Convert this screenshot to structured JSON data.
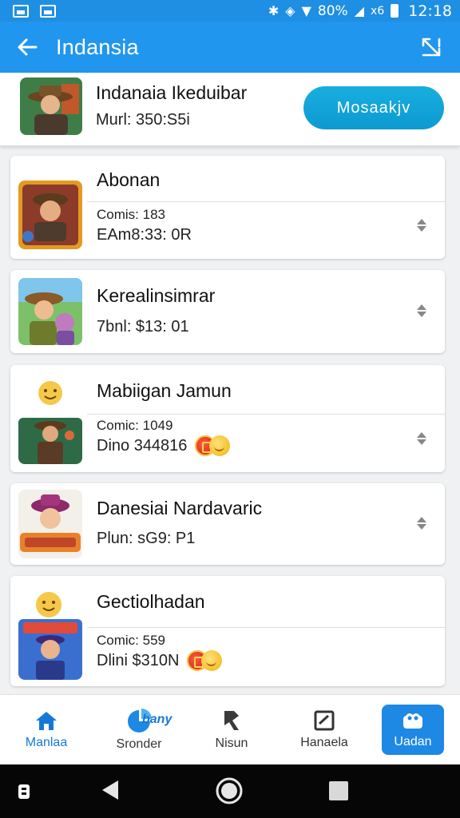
{
  "status_bar": {
    "battery_text": "80%",
    "signal_text": "x6",
    "time": "12:18"
  },
  "app_bar": {
    "title": "Indansia"
  },
  "header": {
    "title": "Indanaia Ikeduibar",
    "subtitle": "Murl: 350:S5i",
    "button_label": "Mosaakjv"
  },
  "items": [
    {
      "title": "Abonan",
      "line1": "Comis: 183",
      "line2": "EAm8:33: 0R",
      "show_coins": false
    },
    {
      "title": "Kerealinsimrar",
      "line1": "",
      "line2": "7bnl: $13: 01",
      "show_coins": false
    },
    {
      "title": "Mabiigan Jamun",
      "line1": "Comic: 1049",
      "line2": "Dino 344816",
      "show_coins": true
    },
    {
      "title": "Danesiai Nardavaric",
      "line1": "",
      "line2": "Plun: sG9: P1",
      "show_coins": false
    },
    {
      "title": "Gectiolhadan",
      "line1": "Comic: 559",
      "line2": "Dlini $310N",
      "show_coins": true
    }
  ],
  "bottom_nav": {
    "brand_word": "bany",
    "items": [
      {
        "label": "Manlaa",
        "icon": "home-icon"
      },
      {
        "label": "Sronder",
        "icon": "chart-icon"
      },
      {
        "label": "Nisun",
        "icon": "pin-icon"
      },
      {
        "label": "Hanaela",
        "icon": "check-square-icon"
      },
      {
        "label": "Uadan",
        "icon": "people-icon"
      }
    ]
  },
  "colors": {
    "primary": "#2196ee",
    "status_bar": "#1e8fe3",
    "header_button": "#12a5d9",
    "active_nav": "#1e88e5"
  }
}
